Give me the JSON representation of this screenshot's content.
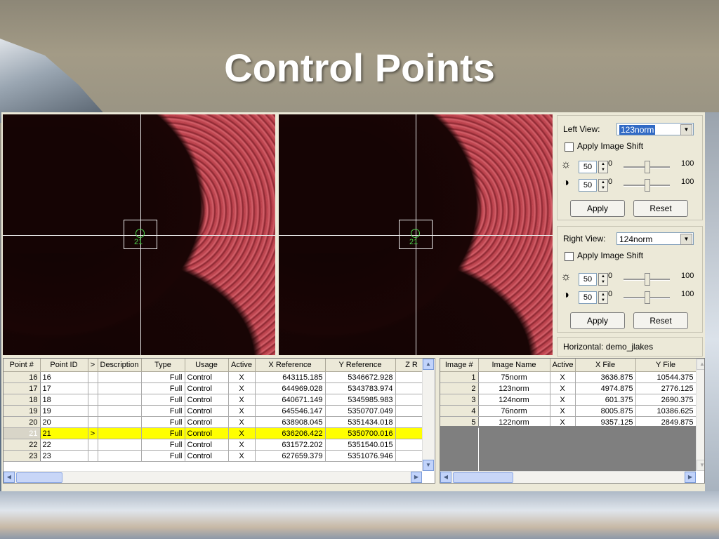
{
  "slide": {
    "title": "Control Points"
  },
  "views": {
    "left": {
      "point_label": "21"
    },
    "right": {
      "point_label": "21"
    }
  },
  "panel": {
    "left_view": {
      "label": "Left View:",
      "selected": "123norm",
      "apply_shift_label": "Apply Image Shift",
      "brightness": {
        "value": "50",
        "offset": "0",
        "max": "100",
        "level": 0.5
      },
      "contrast": {
        "value": "50",
        "offset": "0",
        "max": "100",
        "level": 0.5
      },
      "apply_label": "Apply",
      "reset_label": "Reset"
    },
    "right_view": {
      "label": "Right View:",
      "selected": "124norm",
      "apply_shift_label": "Apply Image Shift",
      "brightness": {
        "value": "50",
        "offset": "0",
        "max": "100",
        "level": 0.5
      },
      "contrast": {
        "value": "50",
        "offset": "0",
        "max": "100",
        "level": 0.5
      },
      "apply_label": "Apply",
      "reset_label": "Reset"
    },
    "horizontal_label": "Horizontal: demo_jlakes"
  },
  "points_table": {
    "columns": [
      "Point #",
      "Point ID",
      ">",
      "Description",
      "Type",
      "Usage",
      "Active",
      "X Reference",
      "Y Reference",
      "Z R"
    ],
    "rows": [
      [
        "16",
        "16",
        "",
        "",
        "Full",
        "Control",
        "X",
        "643115.185",
        "5346672.928"
      ],
      [
        "17",
        "17",
        "",
        "",
        "Full",
        "Control",
        "X",
        "644969.028",
        "5343783.974"
      ],
      [
        "18",
        "18",
        "",
        "",
        "Full",
        "Control",
        "X",
        "640671.149",
        "5345985.983"
      ],
      [
        "19",
        "19",
        "",
        "",
        "Full",
        "Control",
        "X",
        "645546.147",
        "5350707.049"
      ],
      [
        "20",
        "20",
        "",
        "",
        "Full",
        "Control",
        "X",
        "638908.045",
        "5351434.018"
      ],
      [
        "21",
        "21",
        ">",
        "",
        "Full",
        "Control",
        "X",
        "636206.422",
        "5350700.016"
      ],
      [
        "22",
        "22",
        "",
        "",
        "Full",
        "Control",
        "X",
        "631572.202",
        "5351540.015"
      ],
      [
        "23",
        "23",
        "",
        "",
        "Full",
        "Control",
        "X",
        "627659.379",
        "5351076.946"
      ]
    ],
    "selected_row": "21"
  },
  "images_table": {
    "columns": [
      "Image #",
      "Image Name",
      "Active",
      "X File",
      "Y File"
    ],
    "rows": [
      [
        "1",
        "75norm",
        "X",
        "3636.875",
        "10544.375"
      ],
      [
        "2",
        "123norm",
        "X",
        "4974.875",
        "2776.125"
      ],
      [
        "3",
        "124norm",
        "X",
        "601.375",
        "2690.375"
      ],
      [
        "4",
        "76norm",
        "X",
        "8005.875",
        "10386.625"
      ],
      [
        "5",
        "122norm",
        "X",
        "9357.125",
        "2849.875"
      ]
    ]
  },
  "icons": {
    "brightness": "sun-icon",
    "contrast": "contrast-icon"
  }
}
